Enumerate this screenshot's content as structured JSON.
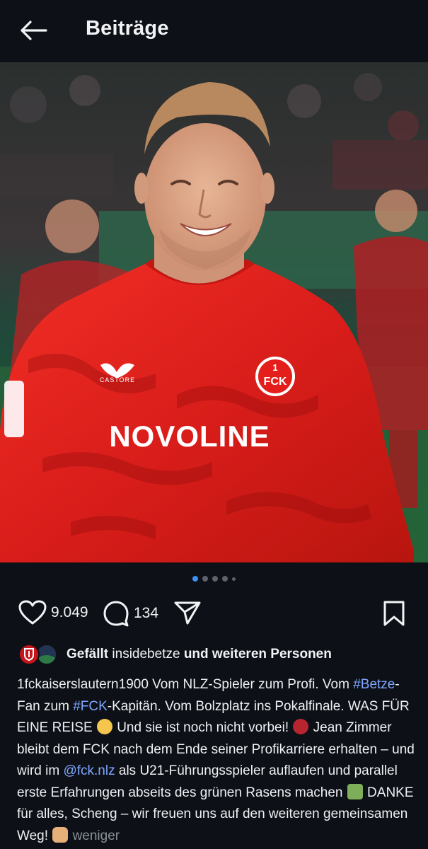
{
  "header": {
    "title": "Beiträge"
  },
  "photo": {
    "jersey_sponsor": "NOVOLINE",
    "jersey_brand": "CASTORE",
    "crest_text": "FCK",
    "crest_number": "1"
  },
  "carousel": {
    "count": 5,
    "active_index": 0
  },
  "actions": {
    "likes_count": "9.049",
    "comments_count": "134"
  },
  "likes": {
    "prefix": "Gefällt",
    "user": "insidebetze",
    "suffix": "und weiteren Personen"
  },
  "caption": {
    "author": "1fckaiserslautern1900",
    "t1": " Vom NLZ-Spieler zum Profi. Vom ",
    "h1": "#Betze",
    "t2": "-Fan zum ",
    "h2": "#FCK",
    "t3": "-Kapitän. Vom Bolzplatz ins Pokalfinale. WAS FÜR EINE REISE ",
    "t4": " Und sie ist noch nicht vorbei! ",
    "t5": " Jean Zimmer bleibt dem FCK nach dem Ende seiner Profikarriere erhalten – und wird im ",
    "m1": "@fck.nlz",
    "t6": " als U21-Führungsspieler auflaufen und parallel erste Erfahrungen abseits des grünen Rasens machen ",
    "t7": " DANKE für alles, Scheng – wir freuen uns auf den weiteren gemeinsamen Weg! ",
    "less": "weniger"
  },
  "colors": {
    "accent": "#3b8ff5",
    "link": "#7fa6ff",
    "background": "#0d1117",
    "jersey": "#e4231f"
  },
  "icons": [
    "back-arrow-icon",
    "heart-icon",
    "comment-icon",
    "send-icon",
    "bookmark-icon"
  ]
}
